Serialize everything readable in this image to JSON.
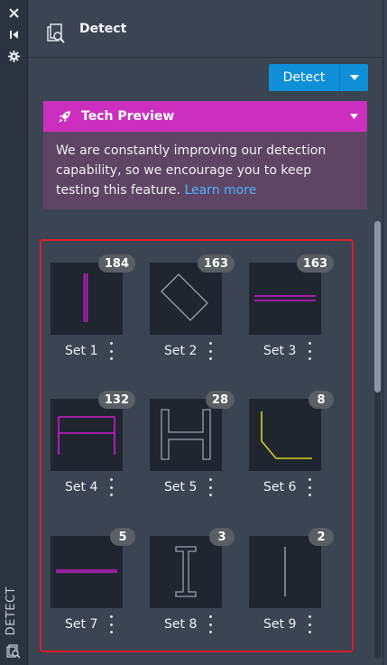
{
  "strip": {
    "icons": [
      "close-icon",
      "collapse-icon",
      "settings-icon",
      "detect-icon"
    ],
    "label": "DETECT"
  },
  "header": {
    "title": "Detect",
    "icon": "detect-icon"
  },
  "detect_button": {
    "label": "Detect",
    "dropdown_icon": "caret-down-icon"
  },
  "tech_preview": {
    "title": "Tech Preview",
    "body": "We are constantly improving our detection capability, so we encourage you to keep testing this feature.",
    "link": "Learn more",
    "accent": "#cc2fbf"
  },
  "sets": [
    {
      "label": "Set 1",
      "count": "184",
      "shape": "vertical-line-magenta"
    },
    {
      "label": "Set 2",
      "count": "163",
      "shape": "rotated-rectangle-gray"
    },
    {
      "label": "Set 3",
      "count": "163",
      "shape": "double-horizontal-line-magenta"
    },
    {
      "label": "Set 4",
      "count": "132",
      "shape": "frame-magenta"
    },
    {
      "label": "Set 5",
      "count": "28",
      "shape": "h-shape-gray"
    },
    {
      "label": "Set 6",
      "count": "8",
      "shape": "l-bend-yellow"
    },
    {
      "label": "Set 7",
      "count": "5",
      "shape": "horizontal-line-magenta"
    },
    {
      "label": "Set 8",
      "count": "3",
      "shape": "i-beam-gray"
    },
    {
      "label": "Set 9",
      "count": "2",
      "shape": "vertical-line-gray"
    }
  ]
}
